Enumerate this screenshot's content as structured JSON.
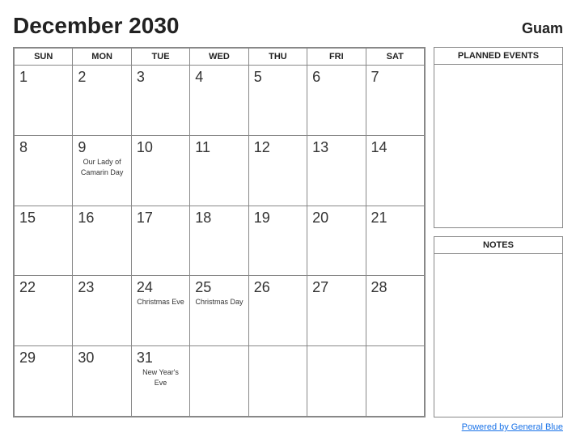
{
  "header": {
    "title": "December 2030",
    "location": "Guam"
  },
  "calendar": {
    "days_of_week": [
      "SUN",
      "MON",
      "TUE",
      "WED",
      "THU",
      "FRI",
      "SAT"
    ],
    "weeks": [
      [
        {
          "day": "",
          "events": []
        },
        {
          "day": "",
          "events": []
        },
        {
          "day": "",
          "events": []
        },
        {
          "day": "",
          "events": []
        },
        {
          "day": "",
          "events": []
        },
        {
          "day": "",
          "events": []
        },
        {
          "day": "",
          "events": []
        }
      ],
      [
        {
          "day": "1",
          "events": []
        },
        {
          "day": "2",
          "events": []
        },
        {
          "day": "3",
          "events": []
        },
        {
          "day": "4",
          "events": []
        },
        {
          "day": "5",
          "events": []
        },
        {
          "day": "6",
          "events": []
        },
        {
          "day": "7",
          "events": []
        }
      ],
      [
        {
          "day": "8",
          "events": []
        },
        {
          "day": "9",
          "events": [
            "Our Lady of",
            "Camarin Day"
          ]
        },
        {
          "day": "10",
          "events": []
        },
        {
          "day": "11",
          "events": []
        },
        {
          "day": "12",
          "events": []
        },
        {
          "day": "13",
          "events": []
        },
        {
          "day": "14",
          "events": []
        }
      ],
      [
        {
          "day": "15",
          "events": []
        },
        {
          "day": "16",
          "events": []
        },
        {
          "day": "17",
          "events": []
        },
        {
          "day": "18",
          "events": []
        },
        {
          "day": "19",
          "events": []
        },
        {
          "day": "20",
          "events": []
        },
        {
          "day": "21",
          "events": []
        }
      ],
      [
        {
          "day": "22",
          "events": []
        },
        {
          "day": "23",
          "events": []
        },
        {
          "day": "24",
          "events": [
            "Christmas Eve"
          ]
        },
        {
          "day": "25",
          "events": [
            "Christmas Day"
          ]
        },
        {
          "day": "26",
          "events": []
        },
        {
          "day": "27",
          "events": []
        },
        {
          "day": "28",
          "events": []
        }
      ],
      [
        {
          "day": "29",
          "events": []
        },
        {
          "day": "30",
          "events": []
        },
        {
          "day": "31",
          "events": [
            "New Year's",
            "Eve"
          ]
        },
        {
          "day": "",
          "events": []
        },
        {
          "day": "",
          "events": []
        },
        {
          "day": "",
          "events": []
        },
        {
          "day": "",
          "events": []
        }
      ]
    ]
  },
  "sidebar": {
    "planned_events_label": "PLANNED EVENTS",
    "notes_label": "NOTES"
  },
  "footer": {
    "link_text": "Powered by General Blue"
  }
}
